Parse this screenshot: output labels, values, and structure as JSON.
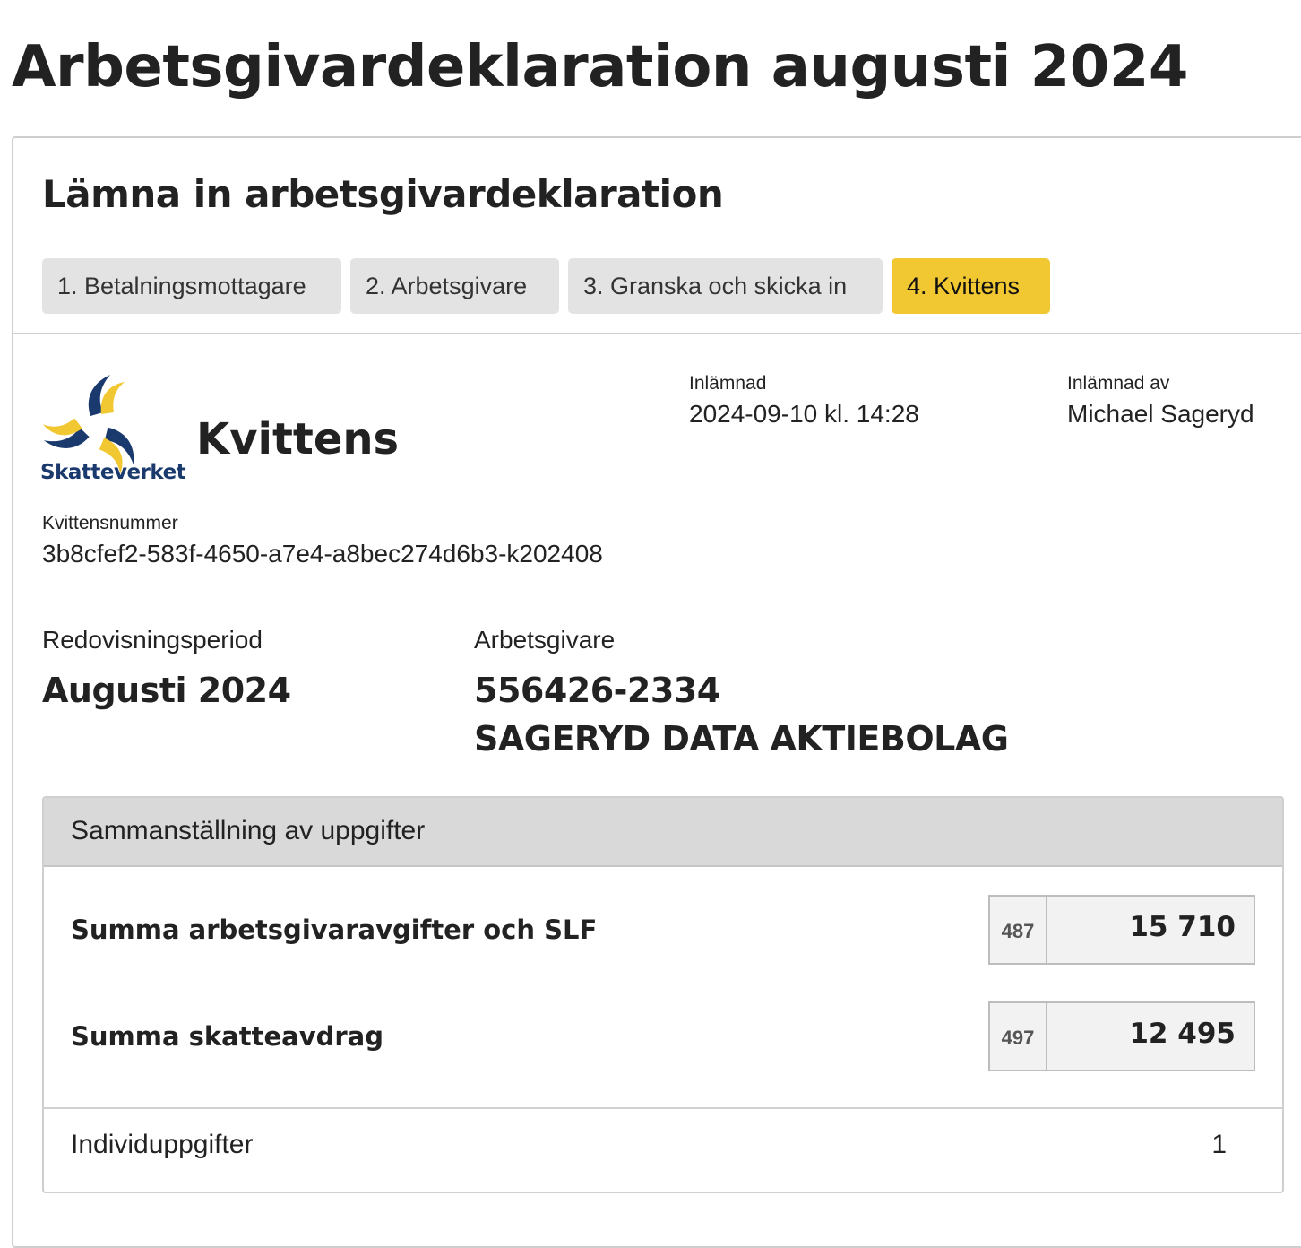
{
  "page": {
    "title": "Arbetsgivardeklaration augusti 2024"
  },
  "card": {
    "title": "Lämna in arbetsgivardeklaration"
  },
  "steps": [
    {
      "label": "1. Betalningsmottagare",
      "active": false
    },
    {
      "label": "2. Arbetsgivare",
      "active": false
    },
    {
      "label": "3. Granska och skicka in",
      "active": false
    },
    {
      "label": "4. Kvittens",
      "active": true
    }
  ],
  "receipt": {
    "logo_text": "Skatteverket",
    "title": "Kvittens",
    "submitted_label": "Inlämnad",
    "submitted_value": "2024-09-10 kl. 14:28",
    "submitted_by_label": "Inlämnad av",
    "submitted_by_value": "Michael Sageryd",
    "number_label": "Kvittensnummer",
    "number_value": "3b8cfef2-583f-4650-a7e4-a8bec274d6b3-k202408"
  },
  "period": {
    "label": "Redovisningsperiod",
    "value": "Augusti 2024"
  },
  "employer": {
    "label": "Arbetsgivare",
    "org_number": "556426-2334",
    "name": "SAGERYD DATA AKTIEBOLAG"
  },
  "summary": {
    "header": "Sammanställning av uppgifter",
    "rows": [
      {
        "label": "Summa arbetsgivaravgifter och SLF",
        "code": "487",
        "value": "15 710"
      },
      {
        "label": "Summa skatteavdrag",
        "code": "497",
        "value": "12 495"
      }
    ],
    "individ_label": "Individuppgifter",
    "individ_count": "1"
  },
  "colors": {
    "active_step": "#f2c832",
    "inactive_step": "#e3e3e3",
    "logo_navy": "#1a3a6e",
    "logo_yellow": "#f2c832"
  },
  "icons": {
    "logo": "skatteverket-logo-icon"
  }
}
